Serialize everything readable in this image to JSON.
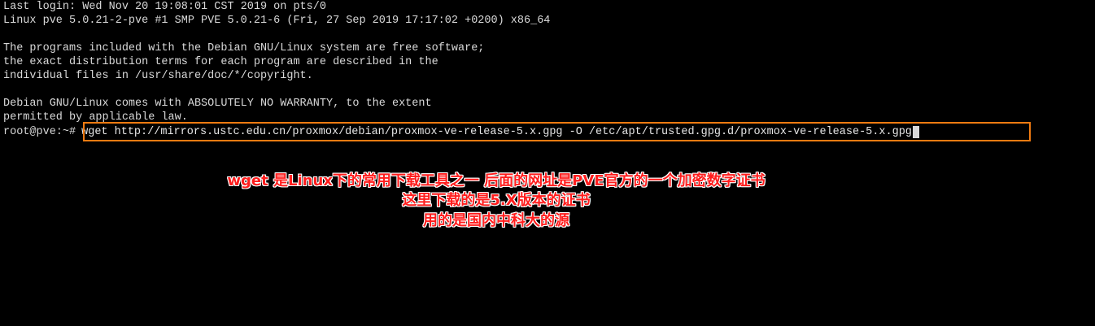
{
  "terminal": {
    "lines": [
      "Last login: Wed Nov 20 19:08:01 CST 2019 on pts/0",
      "Linux pve 5.0.21-2-pve #1 SMP PVE 5.0.21-6 (Fri, 27 Sep 2019 17:17:02 +0200) x86_64",
      "",
      "The programs included with the Debian GNU/Linux system are free software;",
      "the exact distribution terms for each program are described in the",
      "individual files in /usr/share/doc/*/copyright.",
      "",
      "Debian GNU/Linux comes with ABSOLUTELY NO WARRANTY, to the extent",
      "permitted by applicable law."
    ],
    "prompt": "root@pve:~#",
    "command": "wget http://mirrors.ustc.edu.cn/proxmox/debian/proxmox-ve-release-5.x.gpg -O /etc/apt/trusted.gpg.d/proxmox-ve-release-5.x.gpg"
  },
  "annotation": {
    "line1": "wget 是Linux下的常用下载工具之一 后面的网址是PVE官方的一个加密数字证书",
    "line2": "这里下载的是5.X版本的证书",
    "line3": "用的是国内中科大的源",
    "color": "#ff1d1d",
    "box_color": "#f07b11"
  }
}
